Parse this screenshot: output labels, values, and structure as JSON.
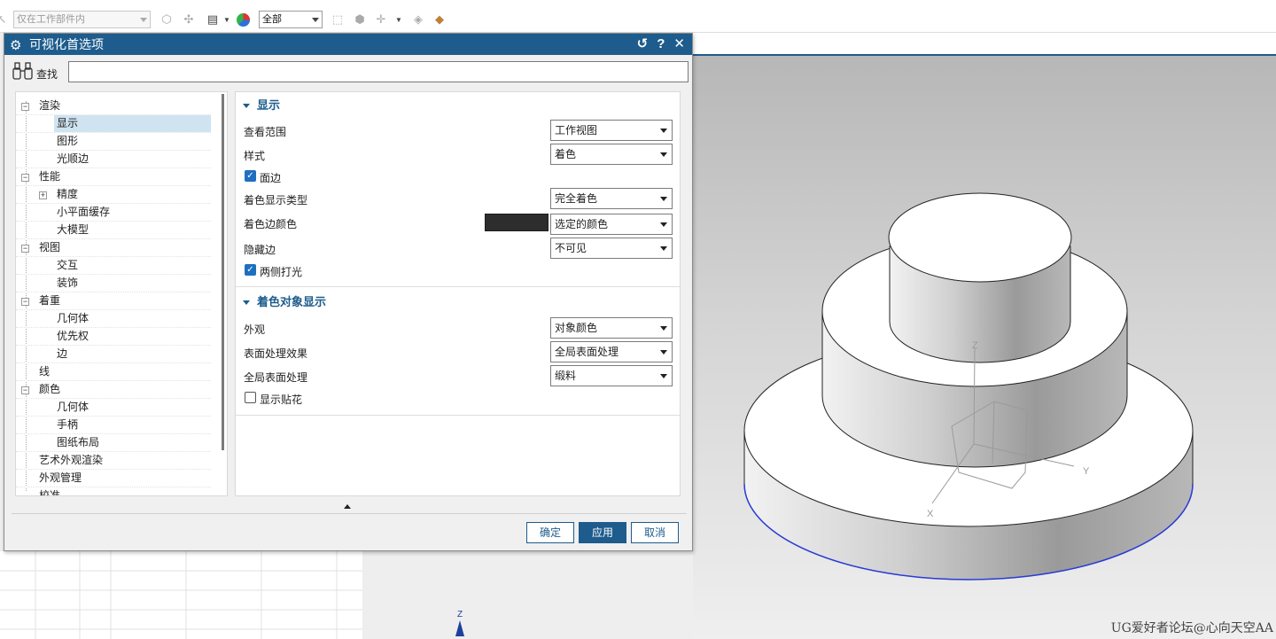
{
  "toolbar": {
    "scope_combo": "仅在工作部件内",
    "filter_combo": "全部"
  },
  "dialog": {
    "title": "可视化首选项",
    "search_label": "查找",
    "search_value": "",
    "tree": [
      {
        "label": "渲染",
        "level": 0,
        "expander": "−"
      },
      {
        "label": "显示",
        "level": 1,
        "selected": true
      },
      {
        "label": "图形",
        "level": 1
      },
      {
        "label": "光顺边",
        "level": 1
      },
      {
        "label": "性能",
        "level": 0,
        "expander": "−"
      },
      {
        "label": "精度",
        "level": 1,
        "expander": "+"
      },
      {
        "label": "小平面缓存",
        "level": 1
      },
      {
        "label": "大模型",
        "level": 1
      },
      {
        "label": "视图",
        "level": 0,
        "expander": "−"
      },
      {
        "label": "交互",
        "level": 1
      },
      {
        "label": "装饰",
        "level": 1
      },
      {
        "label": "着重",
        "level": 0,
        "expander": "−"
      },
      {
        "label": "几何体",
        "level": 1
      },
      {
        "label": "优先权",
        "level": 1
      },
      {
        "label": "边",
        "level": 1
      },
      {
        "label": "线",
        "level": 0
      },
      {
        "label": "颜色",
        "level": 0,
        "expander": "−"
      },
      {
        "label": "几何体",
        "level": 1
      },
      {
        "label": "手柄",
        "level": 1
      },
      {
        "label": "图纸布局",
        "level": 1
      },
      {
        "label": "艺术外观渲染",
        "level": 0
      },
      {
        "label": "外观管理",
        "level": 0
      },
      {
        "label": "校准",
        "level": 0
      }
    ],
    "display_group": {
      "title": "显示",
      "view_range_label": "查看范围",
      "view_range_value": "工作视图",
      "style_label": "样式",
      "style_value": "着色",
      "face_edges_label": "面边",
      "face_edges_checked": true,
      "shaded_type_label": "着色显示类型",
      "shaded_type_value": "完全着色",
      "shaded_edge_color_label": "着色边颜色",
      "shaded_edge_color_swatch": "#2d2d2d",
      "shaded_edge_color_value": "选定的颜色",
      "hidden_edges_label": "隐藏边",
      "hidden_edges_value": "不可见",
      "two_side_light_label": "两侧打光",
      "two_side_light_checked": true
    },
    "shaded_group": {
      "title": "着色对象显示",
      "appearance_label": "外观",
      "appearance_value": "对象颜色",
      "surface_effect_label": "表面处理效果",
      "surface_effect_value": "全局表面处理",
      "global_surface_label": "全局表面处理",
      "global_surface_value": "缎料",
      "show_decals_label": "显示贴花",
      "show_decals_checked": false
    },
    "buttons": {
      "ok": "确定",
      "apply": "应用",
      "cancel": "取消"
    }
  },
  "viewport": {
    "axis_z": "Z",
    "axis_y": "Y",
    "axis_x": "X",
    "triad_z": "Z",
    "watermark": "UG爱好者论坛@心向天空AA"
  },
  "colors": {
    "accent": "#1d5c8c",
    "selection": "#cfe3f0",
    "edge_highlight": "#2a3bd8"
  }
}
